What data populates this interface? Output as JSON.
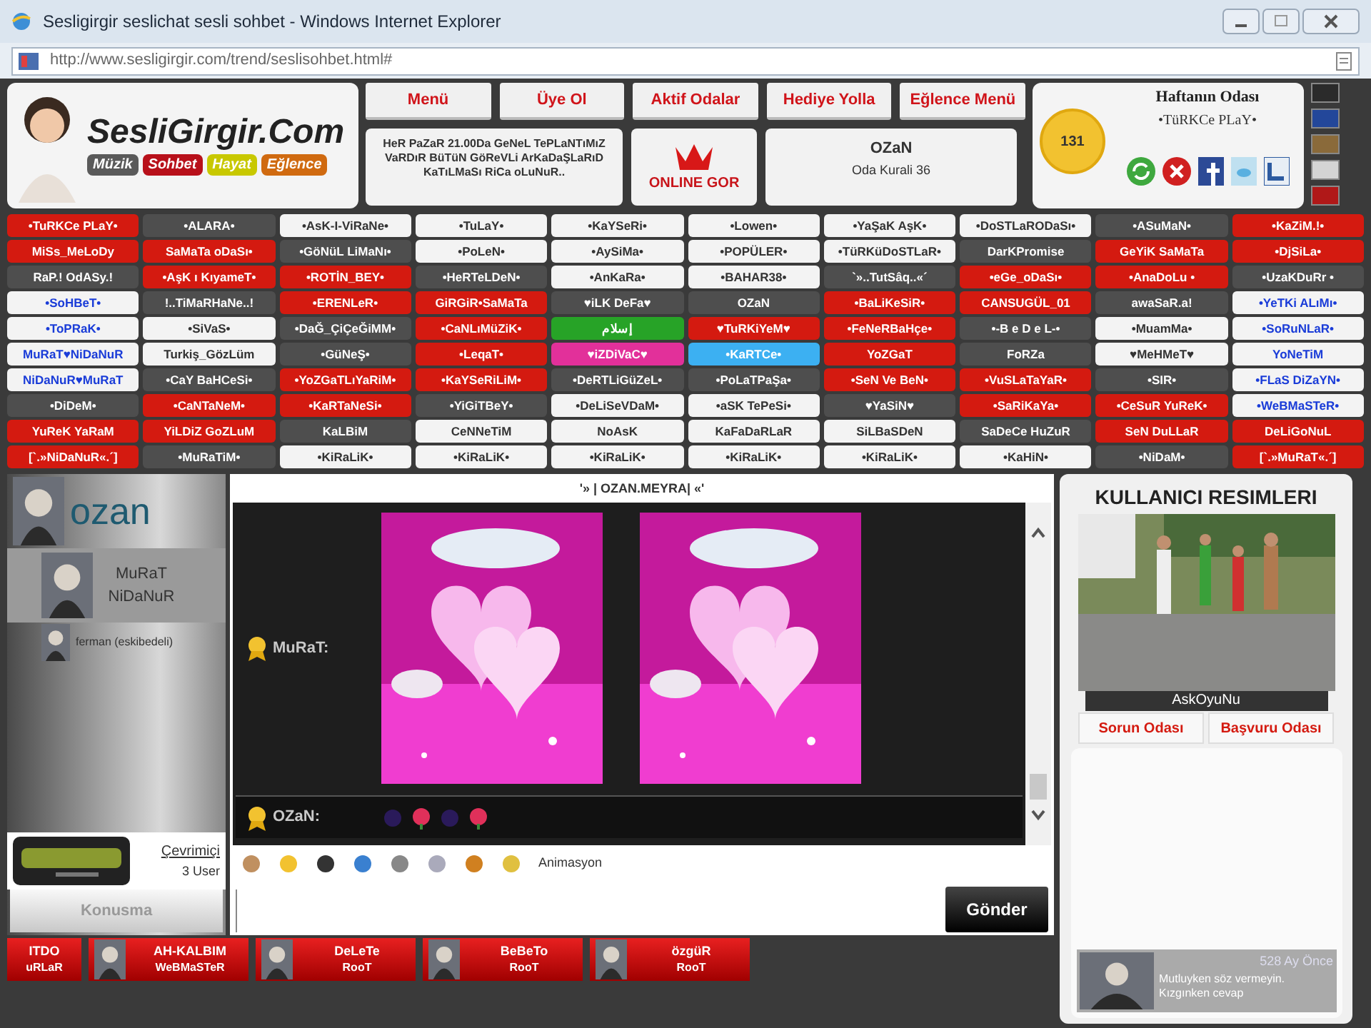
{
  "window": {
    "title": "Sesligirgir seslichat sesli sohbet - Windows Internet Explorer",
    "address": "http://www.sesligirgir.com/trend/seslisohbet.html#"
  },
  "logo": {
    "title": "SesliGirgir.Com",
    "tags": [
      "Müzik",
      "Sohbet",
      "Hayat",
      "Eğlence"
    ]
  },
  "nav": [
    "Menü",
    "Üye Ol",
    "Aktif Odalar",
    "Hediye Yolla",
    "Eğlence Menü"
  ],
  "announcement": "HeR PaZaR 21.00Da GeNeL TePLaNTıMıZ VaRDıR BüTüN GöReVLi ArKaDaŞLaRıD KaTıLMaSı RiCa oLuNuR..",
  "online_button": "ONLINE GOR",
  "room_info": {
    "owner": "OZaN",
    "rules": "Oda Kurali 36"
  },
  "weekly_room": {
    "title": "Haftanın Odası",
    "name": "•TüRKCe PLaY•",
    "badge": "131"
  },
  "theme_swatches": [
    {
      "color": "#2b2b2b"
    },
    {
      "color": "#23479a"
    },
    {
      "color": "#8a6a3a"
    },
    {
      "color": "#d4d4d4"
    },
    {
      "color": "#b01818"
    }
  ],
  "rooms": [
    {
      "label": "•TuRKCe PLaY•",
      "kind": "red"
    },
    {
      "label": "•ALARA•",
      "kind": "dark"
    },
    {
      "label": "•AsK-I-ViRaNe•",
      "kind": "light"
    },
    {
      "label": "•TuLaY•",
      "kind": "light"
    },
    {
      "label": "•KaYSeRi•",
      "kind": "light"
    },
    {
      "label": "•Lowen•",
      "kind": "light"
    },
    {
      "label": "•YaŞaK AşK•",
      "kind": "light"
    },
    {
      "label": "•DoSTLaRODaSı•",
      "kind": "light"
    },
    {
      "label": "•ASuMaN•",
      "kind": "dark"
    },
    {
      "label": "•KaZiM.!•",
      "kind": "red"
    },
    {
      "label": "MiSs_MeLoDy",
      "kind": "red"
    },
    {
      "label": "SaMaTa oDaSı•",
      "kind": "red"
    },
    {
      "label": "•GöNüL LiMaNı•",
      "kind": "dark"
    },
    {
      "label": "•PoLeN•",
      "kind": "light"
    },
    {
      "label": "•AySiMa•",
      "kind": "light"
    },
    {
      "label": "•POPÜLER•",
      "kind": "light"
    },
    {
      "label": "•TüRKüDoSTLaR•",
      "kind": "light"
    },
    {
      "label": "DarKPromise",
      "kind": "dark"
    },
    {
      "label": "GeYiK SaMaTa",
      "kind": "red"
    },
    {
      "label": "•DjSiLa•",
      "kind": "red"
    },
    {
      "label": "RaP.! OdASy.!",
      "kind": "dark"
    },
    {
      "label": "•AşK ı KıyameT•",
      "kind": "red"
    },
    {
      "label": "•ROTİN_BEY•",
      "kind": "red"
    },
    {
      "label": "•HeRTeLDeN•",
      "kind": "dark"
    },
    {
      "label": "•AnKaRa•",
      "kind": "light"
    },
    {
      "label": "•BAHAR38•",
      "kind": "light"
    },
    {
      "label": "`»..TutSâq..«´",
      "kind": "dark"
    },
    {
      "label": "•eGe_oDaSı•",
      "kind": "red"
    },
    {
      "label": "•AnaDoLu •",
      "kind": "red"
    },
    {
      "label": "•UzaKDuRr •",
      "kind": "dark"
    },
    {
      "label": "•SoHBeT•",
      "kind": "link"
    },
    {
      "label": "!..TiMaRHaNe..!",
      "kind": "dark"
    },
    {
      "label": "•ERENLeR•",
      "kind": "red"
    },
    {
      "label": "GiRGiR•SaMaTa",
      "kind": "red"
    },
    {
      "label": "♥iLK DeFa♥",
      "kind": "dark"
    },
    {
      "label": "OZaN",
      "kind": "dark"
    },
    {
      "label": "•BaLiKeSiR•",
      "kind": "red"
    },
    {
      "label": "CANSUGÜL_01",
      "kind": "red"
    },
    {
      "label": "awaSaR.a!",
      "kind": "dark"
    },
    {
      "label": "•YeTKi ALıMı•",
      "kind": "link"
    },
    {
      "label": "•ToPRaK•",
      "kind": "link"
    },
    {
      "label": "•SiVaS•",
      "kind": "light"
    },
    {
      "label": "•DaĞ_ÇiÇeĞiMM•",
      "kind": "dark"
    },
    {
      "label": "•CaNLıMüZiK•",
      "kind": "red"
    },
    {
      "label": "إسلام",
      "kind": "green"
    },
    {
      "label": "♥TuRKiYeM♥",
      "kind": "red"
    },
    {
      "label": "•FeNeRBaHçe•",
      "kind": "red"
    },
    {
      "label": "•-B e D e L-•",
      "kind": "dark"
    },
    {
      "label": "•MuamMa•",
      "kind": "light"
    },
    {
      "label": "•SoRuNLaR•",
      "kind": "link"
    },
    {
      "label": "MuRaT♥NiDaNuR",
      "kind": "link"
    },
    {
      "label": "Turkiş_GözLüm",
      "kind": "light"
    },
    {
      "label": "•GüNeŞ•",
      "kind": "dark"
    },
    {
      "label": "•LeqaT•",
      "kind": "red"
    },
    {
      "label": "♥iZDiVaC♥",
      "kind": "pink"
    },
    {
      "label": "•KaRTCe•",
      "kind": "cyan"
    },
    {
      "label": "YoZGaT",
      "kind": "red"
    },
    {
      "label": "FoRZa",
      "kind": "dark"
    },
    {
      "label": "♥MeHMeT♥",
      "kind": "light"
    },
    {
      "label": "YoNeTiM",
      "kind": "link"
    },
    {
      "label": "NiDaNuR♥MuRaT",
      "kind": "link"
    },
    {
      "label": "•CaY BaHCeSi•",
      "kind": "dark"
    },
    {
      "label": "•YoZGaTLıYaRiM•",
      "kind": "red"
    },
    {
      "label": "•KaYSeRiLiM•",
      "kind": "red"
    },
    {
      "label": "•DeRTLiGüZeL•",
      "kind": "dark"
    },
    {
      "label": "•PoLaTPaŞa•",
      "kind": "dark"
    },
    {
      "label": "•SeN Ve BeN•",
      "kind": "red"
    },
    {
      "label": "•VuSLaTaYaR•",
      "kind": "red"
    },
    {
      "label": "•SIR•",
      "kind": "dark"
    },
    {
      "label": "•FLaS DiZaYN•",
      "kind": "link"
    },
    {
      "label": "•DiDeM•",
      "kind": "dark"
    },
    {
      "label": "•CaNTaNeM•",
      "kind": "red"
    },
    {
      "label": "•KaRTaNeSi•",
      "kind": "red"
    },
    {
      "label": "•YiGiTBeY•",
      "kind": "dark"
    },
    {
      "label": "•DeLiSeVDaM•",
      "kind": "light"
    },
    {
      "label": "•aSK TePeSi•",
      "kind": "light"
    },
    {
      "label": "♥YaSiN♥",
      "kind": "dark"
    },
    {
      "label": "•SaRiKaYa•",
      "kind": "red"
    },
    {
      "label": "•CeSuR YuReK•",
      "kind": "red"
    },
    {
      "label": "•WeBMaSTeR•",
      "kind": "link"
    },
    {
      "label": "YuReK YaRaM",
      "kind": "red"
    },
    {
      "label": "YiLDiZ GoZLuM",
      "kind": "red"
    },
    {
      "label": "KaLBiM",
      "kind": "dark"
    },
    {
      "label": "CeNNeTiM",
      "kind": "light"
    },
    {
      "label": "NoAsK",
      "kind": "light"
    },
    {
      "label": "KaFaDaRLaR",
      "kind": "light"
    },
    {
      "label": "SiLBaSDeN",
      "kind": "light"
    },
    {
      "label": "SaDeCe HuZuR",
      "kind": "dark"
    },
    {
      "label": "SeN DuLLaR",
      "kind": "red"
    },
    {
      "label": "DeLiGoNuL",
      "kind": "red"
    },
    {
      "label": "[`.»NiDaNuR«.´]",
      "kind": "red"
    },
    {
      "label": "•MuRaTiM•",
      "kind": "dark"
    },
    {
      "label": "•KiRaLiK•",
      "kind": "light"
    },
    {
      "label": "•KiRaLiK•",
      "kind": "light"
    },
    {
      "label": "•KiRaLiK•",
      "kind": "light"
    },
    {
      "label": "•KiRaLiK•",
      "kind": "light"
    },
    {
      "label": "•KiRaLiK•",
      "kind": "light"
    },
    {
      "label": "•KaHiN•",
      "kind": "light"
    },
    {
      "label": "•NiDaM•",
      "kind": "dark"
    },
    {
      "label": "[`.»MuRaT«.´]",
      "kind": "red"
    }
  ],
  "users": [
    {
      "name": "ozan",
      "kind": "big",
      "selected": false
    },
    {
      "name": "MuRaT NiDaNuR",
      "kind": "medium",
      "selected": true
    },
    {
      "name": "ferman (eskibedeli)",
      "kind": "small",
      "selected": false
    }
  ],
  "online": {
    "label": "Çevrimiçi",
    "count": "3 User"
  },
  "talk_button": "Konusma",
  "chat": {
    "title": "'» | OZAN.MEYRA| «'",
    "messages": [
      {
        "sender": "MuRaT:",
        "kind": "images"
      },
      {
        "sender": "OZaN:",
        "kind": "roses"
      }
    ],
    "toolbar_label": "Animasyon",
    "send_button": "Gönder"
  },
  "bottom_users": [
    {
      "name": "ITDO",
      "role": "uRLaR"
    },
    {
      "name": "AH-KALBIM",
      "role": "WeBMaSTeR"
    },
    {
      "name": "DeLeTe",
      "role": "RooT"
    },
    {
      "name": "BeBeTo",
      "role": "RooT"
    },
    {
      "name": "özgüR",
      "role": "RooT"
    }
  ],
  "side": {
    "title": "KULLANICI RESIMLERI",
    "photo_caption": "AskOyuNu",
    "buttons": [
      "Sorun Odası",
      "Başvuru Odası"
    ],
    "post": {
      "time": "528 Ay Önce",
      "text": "Mutluyken söz vermeyin. Kızgınken cevap"
    }
  }
}
